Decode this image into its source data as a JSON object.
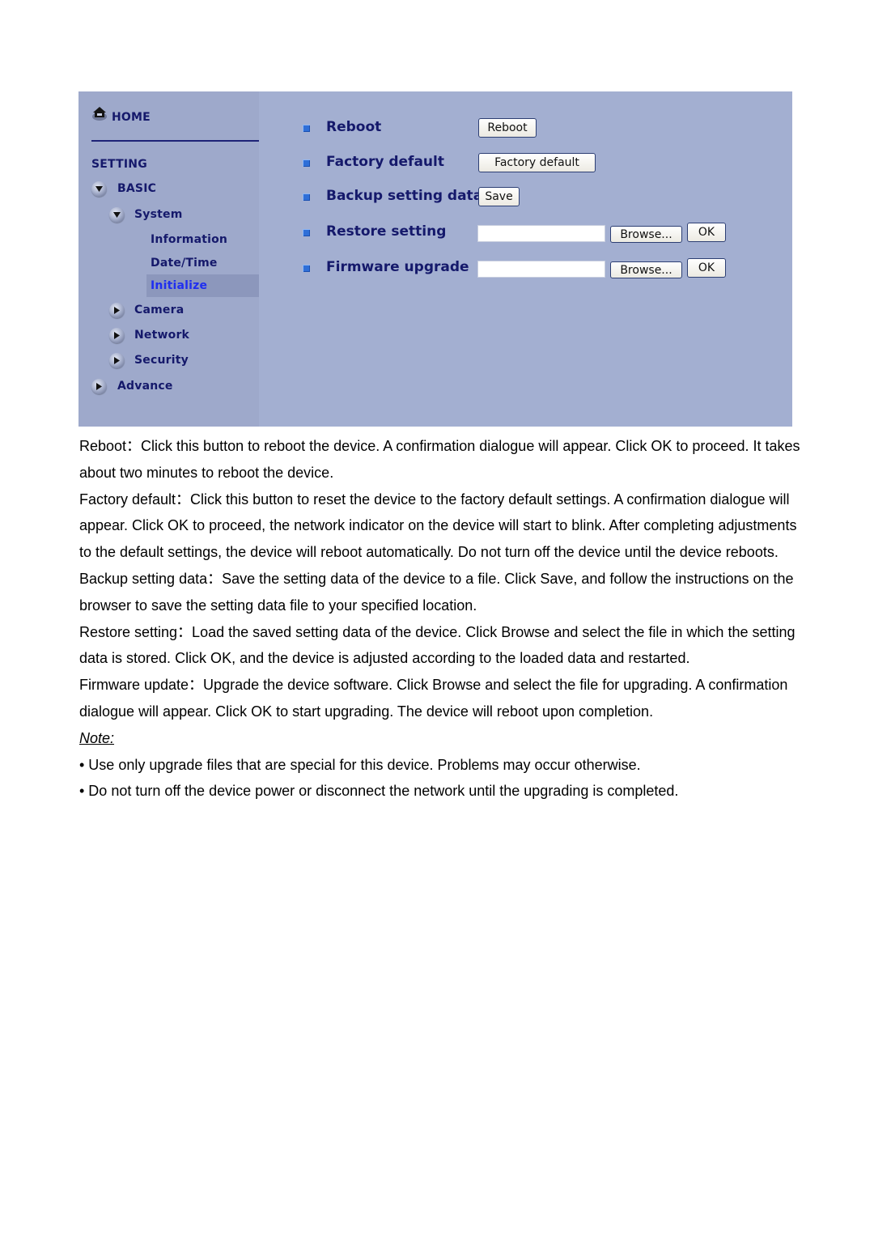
{
  "sidebar": {
    "home_label": "HOME",
    "setting_label": "SETTING",
    "items": [
      {
        "label": "BASIC",
        "state": "expanded",
        "icon": "chevron-down-icon"
      },
      {
        "label": "System",
        "state": "expanded",
        "icon": "chevron-down-icon"
      },
      {
        "label": "Camera",
        "state": "collapsed",
        "icon": "chevron-right-icon"
      },
      {
        "label": "Network",
        "state": "collapsed",
        "icon": "chevron-right-icon"
      },
      {
        "label": "Security",
        "state": "collapsed",
        "icon": "chevron-right-icon"
      },
      {
        "label": "Advance",
        "state": "collapsed",
        "icon": "chevron-right-icon"
      }
    ],
    "system_links": [
      {
        "label": "Information",
        "active": false
      },
      {
        "label": "Date/Time",
        "active": false
      },
      {
        "label": "Initialize",
        "active": true
      }
    ]
  },
  "content": {
    "rows": [
      {
        "label": "Reboot",
        "button": "Reboot"
      },
      {
        "label": "Factory default",
        "button": "Factory default"
      },
      {
        "label": "Backup setting data",
        "button": "Save"
      },
      {
        "label": "Restore setting",
        "file_value": "",
        "browse": "Browse...",
        "ok": "OK"
      },
      {
        "label": "Firmware upgrade",
        "file_value": "",
        "browse": "Browse...",
        "ok": "OK"
      }
    ]
  },
  "colors": {
    "panel_bg": "#a3afd1",
    "sidebar_bg": "#9ea9cb",
    "nav_text": "#15196b",
    "active_link": "#1f2ef0",
    "bullet": "#2f6fd8"
  },
  "document": {
    "paragraphs": [
      "Reboot：Click this button to reboot the device. A confirmation dialogue will appear. Click OK to proceed. It takes about two minutes to reboot the device.",
      "Factory default：Click this button to reset the device to the factory default settings. A confirmation dialogue will appear. Click OK to proceed, the network indicator on the device will start to blink. After completing adjustments to the default settings, the device will reboot automatically. Do not turn off the device until the device reboots.",
      "Backup setting data：Save the setting data of the device to a file. Click Save, and follow the instructions on the browser to save the setting data file to your specified location.",
      "Restore setting：Load the saved setting data of the device. Click Browse and select the file in which the setting data is stored. Click OK, and the device is adjusted according to the loaded data and restarted.",
      "Firmware update：Upgrade the device software. Click Browse and select the file for upgrading. A confirmation dialogue will appear. Click OK to start upgrading. The device will reboot upon completion."
    ],
    "note_label": "Note:",
    "notes": [
      "• Use only upgrade files that are special for this device. Problems may occur otherwise.",
      "• Do not turn off the device power or disconnect the network until the upgrading is completed."
    ]
  }
}
